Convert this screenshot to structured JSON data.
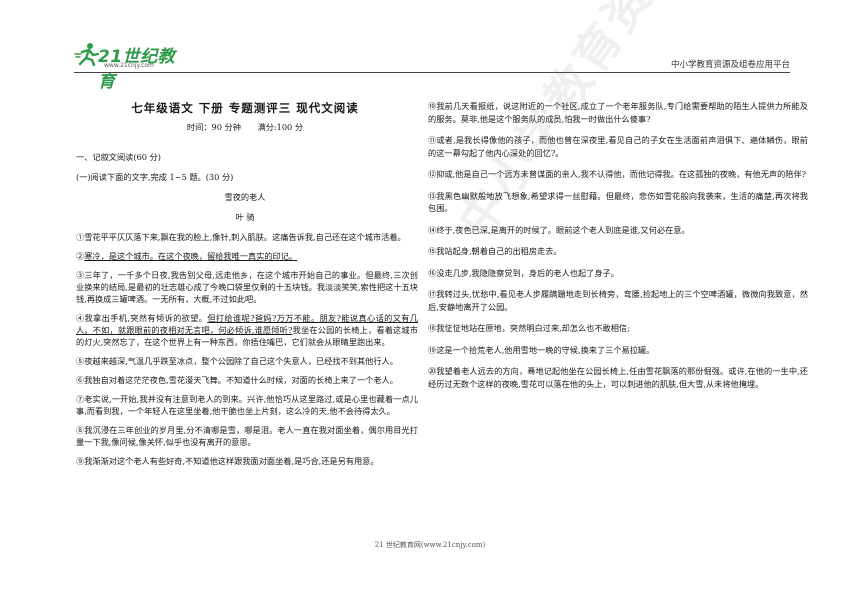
{
  "header": {
    "logo_text": "21世纪教育",
    "logo_url": "www.21cnjy.com",
    "right_text": "中小学教育资源及组卷应用平台"
  },
  "watermark": "中小学教育资源及组卷应用平台",
  "doc": {
    "title": "七年级语文  下册  专题测评三  现代文阅读",
    "time": "时间：90 分钟",
    "score": "满分:100 分",
    "section1": "一、记叙文阅读(60 分)",
    "section1a": "(一)阅读下面的文字,完成 1~5 题。(30 分)",
    "story_title": "雪夜的老人",
    "story_author": "叶  骑"
  },
  "left_paras": [
    {
      "pre": "①雪花平平仄仄落下来,飘在我的脸上,像针,刺入肌肤。这痛告诉我,自己还在这个城市活着。",
      "u": "",
      "post": ""
    },
    {
      "pre": "②",
      "u": "寒冷，是这个城市。在这个夜晚，留给我唯一真实的印记。",
      "post": ""
    },
    {
      "pre": "③三年了，一千多个日夜,我告别父母,远走他乡，在这个城市开始自己的事业。但最终,三次创业换来的结局,是最初的壮志雄心成了今晚口袋里仅剩的十五块钱。我淡淡笑笑,索性把这十五块钱,再换成三罐啤酒。一无所有，大概,不过如此吧。",
      "u": "",
      "post": ""
    },
    {
      "pre": "④我拿出手机,突然有倾诉的欲望。",
      "u": "但打给谁呢?爸妈?万万不能。朋友?能说真心话的又有几人。不如，就跟眼前的夜相对无言吧，何必倾诉,谁愿倾听?",
      "post": "我坐在公园的长椅上，看着这城市的灯火,突然忘了，在这个世界上有一种东西，你捂住嘴巴，它们就会从眼睛里跑出来。"
    },
    {
      "pre": "⑤夜越来越深,气温几乎跌至冰点，整个公园除了自己这个失意人，已经找不到其他行人。",
      "u": "",
      "post": ""
    },
    {
      "pre": "⑥我独自对着这茫茫夜色,雪花漫天飞舞。不知道什么时候，对面的长椅上来了一个老人。",
      "u": "",
      "post": ""
    },
    {
      "pre": "⑦老实说,一开始,我并没有注意到老人的到来。兴许,他恰巧从这里路过,或是心里也藏着一点儿事,而看到我，一个年轻人在这里坐着,他干脆也坐上片刻，这么冷的天,他不会待得太久。",
      "u": "",
      "post": ""
    },
    {
      "pre": "⑧我沉浸在三年创业的岁月里,分不清哪是雪，哪是泪。老人一直在我对面坐着，偶尔用目光打量一下我,像问候,像关怀,似乎也没有离开的意思。",
      "u": "",
      "post": ""
    },
    {
      "pre": "⑨我渐渐对这个老人有些好奇,不知道他这样跟我面对面坐着,是巧合,还是另有用意。",
      "u": "",
      "post": ""
    }
  ],
  "right_paras": [
    "⑩我前几天看报纸，说这附近的一个社区,成立了一个老年服务队,专门给需要帮助的陌生人提供力所能及的服务。莫非,他是这个服务队的成员,怕我一时做出什么傻事?",
    "⑪或者,是我长得像他的孩子，而他也曾在深夜里,看见自己的子女在生活面前声泪俱下、遍体鳞伤，眼前的这一幕勾起了他内心深处的回忆?。",
    "⑫抑或,他是自己一个远方未曾谋面的亲人,我不认得他，而他记得我。在这孤独的夜晚，有他无声的陪伴?",
    "⑬我黑色幽默般地放飞想象,希望求得一丝慰藉。但最终，悲伤如雪花般向我袭来，生活的痛楚,再次将我包围。",
    "⑭终于,夜色已深,是离开的时候了。眼前这个老人到底是谁,又何必在意。",
    "⑮我站起身,朝着自己的出租房走去。",
    "⑯没走几步,我隐隐察觉到，身后的老人也起了身子。",
    "⑰我转过头,忧愁中,看见老人步履蹒跚地走到长椅旁，弯腰,捡起地上的三个空啤酒罐，微微向我致意，然后,安静地离开了公园。",
    "⑱我怔怔地站在原地，突然明白过来,却怎么也不敢相信;",
    "⑲这是一个拾荒老人,他用雪地一晚的守候,换来了三个易拉罐。",
    "⑳我望着老人远去的方向，蓦地记起他坐在公园长椅上,任由雪花飘落的那份倔强。或许,在他的一生中,还经历过无数个这样的夜晚,雪花可以落在他的头上，可以刺进他的肌肤,但大雪,从未将他掩埋。"
  ],
  "footer": "21 世纪教育网(www.21cnjy.com)",
  "colors": {
    "brand_green": "#2f9a4a",
    "text": "#1a1a1a"
  }
}
